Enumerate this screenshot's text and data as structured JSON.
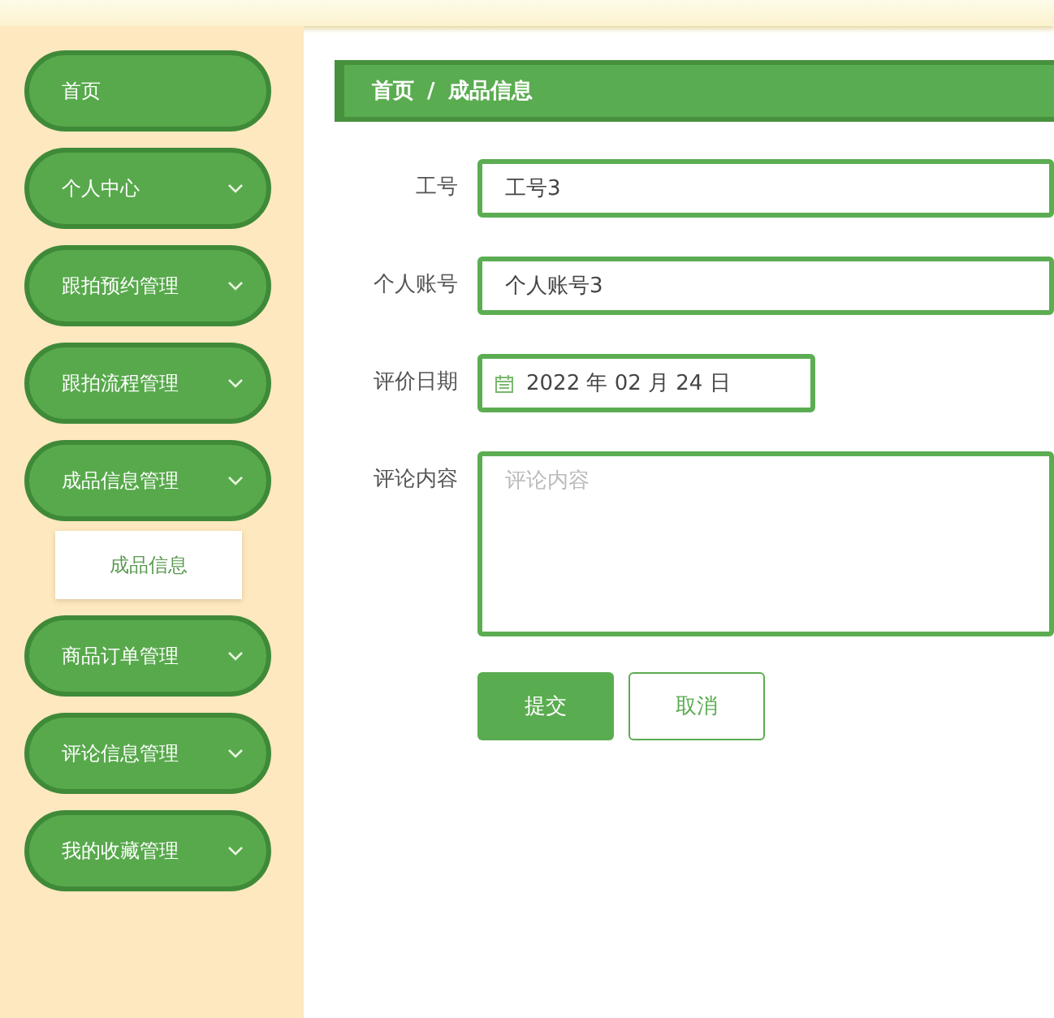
{
  "sidebar": {
    "items": [
      {
        "label": "首页",
        "expandable": false
      },
      {
        "label": "个人中心",
        "expandable": true,
        "expanded": false
      },
      {
        "label": "跟拍预约管理",
        "expandable": true,
        "expanded": false
      },
      {
        "label": "跟拍流程管理",
        "expandable": true,
        "expanded": false
      },
      {
        "label": "成品信息管理",
        "expandable": true,
        "expanded": true,
        "children": [
          {
            "label": "成品信息"
          }
        ]
      },
      {
        "label": "商品订单管理",
        "expandable": true,
        "expanded": false
      },
      {
        "label": "评论信息管理",
        "expandable": true,
        "expanded": false
      },
      {
        "label": "我的收藏管理",
        "expandable": true,
        "expanded": false
      }
    ]
  },
  "breadcrumb": [
    "首页",
    "/",
    "成品信息"
  ],
  "form": {
    "fields": [
      {
        "kind": "text",
        "label": "工号",
        "value": "工号3"
      },
      {
        "kind": "text",
        "label": "个人账号",
        "value": "个人账号3"
      },
      {
        "kind": "date",
        "label": "评价日期",
        "value": "2022 年 02 月 24 日"
      },
      {
        "kind": "textarea",
        "label": "评论内容",
        "placeholder": "评论内容"
      }
    ],
    "buttons": [
      {
        "label": "提交",
        "kind": "primary"
      },
      {
        "label": "取消",
        "kind": "secondary"
      }
    ]
  }
}
